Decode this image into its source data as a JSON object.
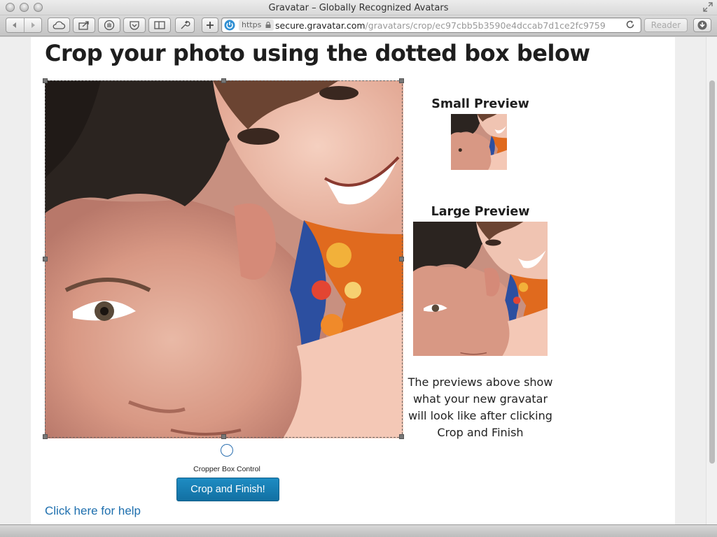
{
  "window": {
    "title": "Gravatar – Globally Recognized Avatars"
  },
  "toolbar": {
    "https_label": "https",
    "url_domain": "secure.gravatar.com",
    "url_path": "/gravatars/crop/ec97cbb5b3590e4dccab7d1ce2fc9759",
    "reader_label": "Reader",
    "reload_icon": "reload-icon"
  },
  "page": {
    "title": "Crop your photo using the dotted box below",
    "control_label": "Cropper Box Control",
    "crop_button": "Crop and Finish!",
    "help_link": "Click here for help",
    "small_preview_title": "Small Preview",
    "large_preview_title": "Large Preview",
    "preview_note": "The previews above show what your new gravatar will look like after clicking Crop and Finish"
  },
  "colors": {
    "accent": "#1e7fb8",
    "link": "#1e6fae",
    "title_text": "#1e1e1e"
  }
}
